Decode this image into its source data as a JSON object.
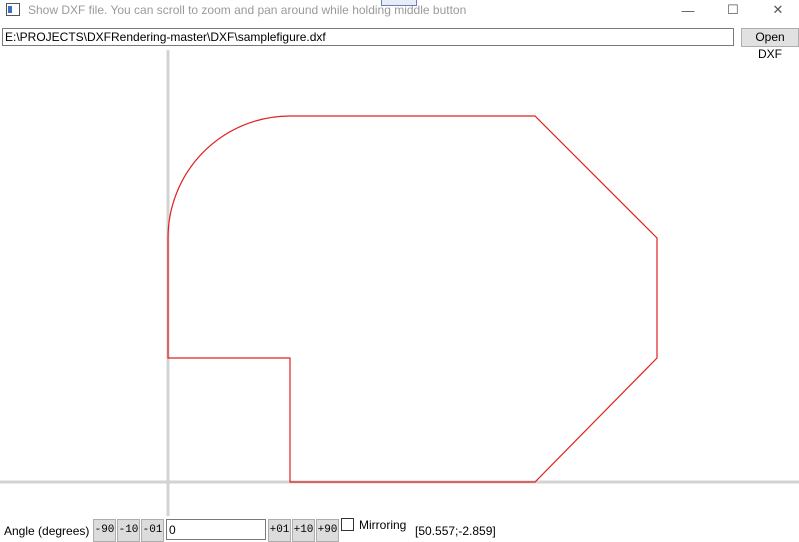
{
  "window": {
    "title": "Show DXF file. You can scroll to zoom and pan around while holding middle button",
    "minimize_glyph": "—",
    "maximize_glyph": "☐",
    "close_glyph": "✕"
  },
  "toolbar": {
    "path_value": "E:\\PROJECTS\\DXFRendering-master\\DXF\\samplefigure.dxf",
    "open_label": "Open DXF"
  },
  "canvas": {
    "axis_color": "#d3d3d3",
    "shape_color": "#e02020"
  },
  "bottom": {
    "angle_label": "Angle (degrees)",
    "buttons": [
      "-90",
      "-10",
      "-01",
      "+01",
      "+10",
      "+90"
    ],
    "angle_value": "0",
    "mirroring_label": "Mirroring",
    "mirroring_checked": false,
    "coordinates": "[50.557;-2.859]"
  }
}
